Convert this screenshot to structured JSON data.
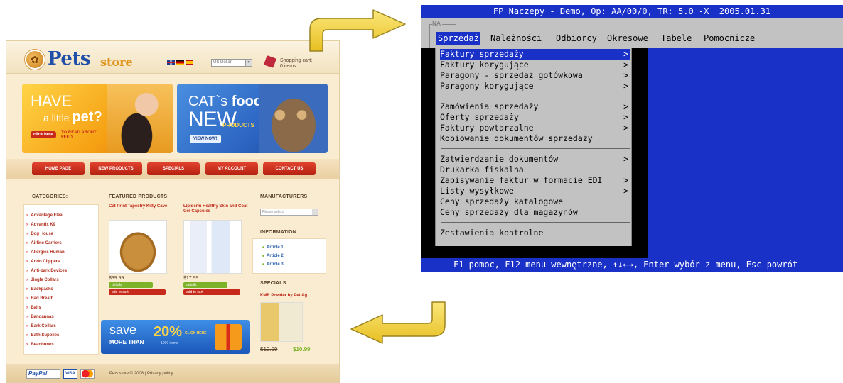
{
  "shop": {
    "logo_main": "Pets",
    "logo_sub": "store",
    "currency": "US Dollar",
    "cart_label": "Shopping cart:",
    "cart_count": "0 items",
    "banner1": {
      "line1": "HAVE",
      "line2": "a little",
      "line2_bold": "pet?",
      "button": "click here",
      "read": "TO READ ABOUT FEED"
    },
    "banner2": {
      "line1": "CAT`s",
      "line1_bold": "food",
      "new": "NEW",
      "products": "PRODUCTS",
      "button": "VIEW NOW!"
    },
    "nav": [
      "HOME PAGE",
      "NEW PRODUCTS",
      "SPECIALS",
      "MY ACCOUNT",
      "CONTACT US"
    ],
    "categories_title": "CATEGORIES:",
    "categories": [
      "Advantage Flea",
      "Advantix K9",
      "Dog House",
      "Airline Carriers",
      "Allergies Human",
      "Ando Clippers",
      "Anti-bark Devices",
      "Jingle Collars",
      "Backpacks",
      "Bad Breath",
      "Balls",
      "Bandannas",
      "Bark Collars",
      "Bath Supplies",
      "Beanbones"
    ],
    "featured_title": "FEATURED PRODUCTS:",
    "products": [
      {
        "title": "Cat Print Tapestry Kitty Cave",
        "price": "$39.99",
        "details": "details",
        "add": "add to cart"
      },
      {
        "title": "Lipiderm Healthy Skin and Coat Gel Capsules",
        "price": "$17.99",
        "details": "details",
        "add": "add to cart"
      }
    ],
    "save": {
      "word": "save",
      "more": "MORE THAN",
      "pct": "20%",
      "items": "1000 items",
      "click": "CLICK HERE"
    },
    "manufacturers_title": "MANUFACTURERS:",
    "manufacturers_placeholder": "Please select",
    "information_title": "INFORMATION:",
    "information": [
      "Article 1",
      "Article 2",
      "Article 3"
    ],
    "specials_title": "SPECIALS:",
    "special": {
      "title": "KMR Powder by Pet Ag",
      "old_price": "$10.99",
      "new_price": "$10.99"
    },
    "footer": {
      "paypal": "PayPal",
      "visa": "VISA",
      "text": "Pets store © 2008  |  Privacy policy"
    }
  },
  "terminal": {
    "title": "FP Naczepy - Demo, Op: AA/00/0, TR: 5.0 -X  2005.01.31",
    "na_label": "NA",
    "menu": [
      "Sprzedaż",
      "Należności",
      "Odbiorcy",
      "Okresowe",
      "Tabele",
      "Pomocnicze"
    ],
    "active_menu": "Sprzedaż",
    "groups": [
      [
        {
          "label": "Faktury sprzedaży",
          "sub": ">",
          "active": true
        },
        {
          "label": "Faktury korygujące",
          "sub": ">"
        },
        {
          "label": "Paragony - sprzedaż gotówkowa",
          "sub": ">"
        },
        {
          "label": "Paragony korygujące",
          "sub": ">"
        }
      ],
      [
        {
          "label": "Zamówienia sprzedaży",
          "sub": ">"
        },
        {
          "label": "Oferty sprzedaży",
          "sub": ">"
        },
        {
          "label": "Faktury powtarzalne",
          "sub": ">"
        },
        {
          "label": "Kopiowanie dokumentów sprzedaży",
          "sub": ""
        }
      ],
      [
        {
          "label": "Zatwierdzanie dokumentów",
          "sub": ">"
        },
        {
          "label": "Drukarka fiskalna",
          "sub": ""
        },
        {
          "label": "Zapisywanie faktur w formacie EDI",
          "sub": ">"
        },
        {
          "label": "Listy wysyłkowe",
          "sub": ">"
        },
        {
          "label": "Ceny sprzedaży katalogowe",
          "sub": ""
        },
        {
          "label": "Ceny sprzedaży dla magazynów",
          "sub": ""
        }
      ],
      [
        {
          "label": "Zestawienia kontrolne",
          "sub": ""
        }
      ]
    ],
    "status": "F1-pomoc, F12-menu wewnętrzne, ↑↓←→, Enter-wybór z menu, Esc-powrót"
  },
  "colors": {
    "terminal_blue": "#1a31c8",
    "terminal_gray": "#c2c2c2",
    "arrow_yellow": "#f0d44a",
    "shop_bg": "#f9ecd0",
    "shop_red": "#c72a1a"
  },
  "icons": [
    "paw-logo-icon",
    "flag-uk-icon",
    "flag-de-icon",
    "flag-es-icon",
    "shopping-cart-icon",
    "arrow-right-curved-icon",
    "arrow-left-curved-icon",
    "gift-box-icon",
    "mastercard-icon"
  ]
}
